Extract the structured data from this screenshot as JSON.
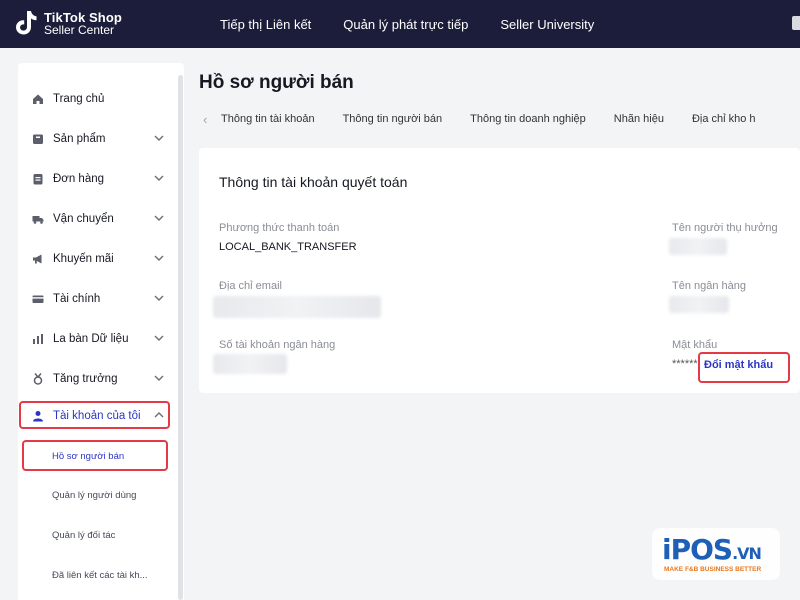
{
  "header": {
    "logo_line1": "TikTok Shop",
    "logo_line2": "Seller Center",
    "nav": [
      "Tiếp thị Liên kết",
      "Quản lý phát trực tiếp",
      "Seller University"
    ]
  },
  "sidebar": {
    "items": [
      {
        "label": "Trang chủ",
        "icon": "home-icon",
        "chevron": false
      },
      {
        "label": "Sản phẩm",
        "icon": "product-icon",
        "chevron": true
      },
      {
        "label": "Đơn hàng",
        "icon": "order-icon",
        "chevron": true
      },
      {
        "label": "Vận chuyển",
        "icon": "truck-icon",
        "chevron": true
      },
      {
        "label": "Khuyến mãi",
        "icon": "megaphone-icon",
        "chevron": true
      },
      {
        "label": "Tài chính",
        "icon": "wallet-icon",
        "chevron": true
      },
      {
        "label": "La bàn Dữ liệu",
        "icon": "bar-chart-icon",
        "chevron": true
      },
      {
        "label": "Tăng trưởng",
        "icon": "medal-icon",
        "chevron": true
      },
      {
        "label": "Tài khoản của tôi",
        "icon": "user-icon",
        "chevron": true,
        "expanded": true
      }
    ],
    "sub_items": [
      "Hồ sơ người bán",
      "Quản lý người dùng",
      "Quản lý đối tác",
      "Đã liên kết các tài kh..."
    ]
  },
  "main": {
    "title": "Hồ sơ người bán",
    "tabs": [
      "Thông tin tài khoản",
      "Thông tin người bán",
      "Thông tin doanh nghiệp",
      "Nhãn hiệu",
      "Địa chỉ kho h"
    ],
    "card": {
      "title": "Thông tin tài khoản quyết toán",
      "payment_method_label": "Phương thức thanh toán",
      "payment_method_value": "LOCAL_BANK_TRANSFER",
      "beneficiary_label": "Tên người thụ hưởng",
      "email_label": "Địa chỉ email",
      "bank_name_label": "Tên ngân hàng",
      "account_number_label": "Số tài khoản ngân hàng",
      "password_label": "Mật khẩu",
      "password_value": "******",
      "change_password": "Đổi mật khẩu"
    }
  },
  "watermark": {
    "brand": "iPOS",
    "suffix": ".VN",
    "tagline": "MAKE F&B BUSINESS BETTER"
  },
  "colors": {
    "header_bg": "#1c1d3a",
    "accent": "#2c35c5",
    "highlight": "#e63946"
  }
}
